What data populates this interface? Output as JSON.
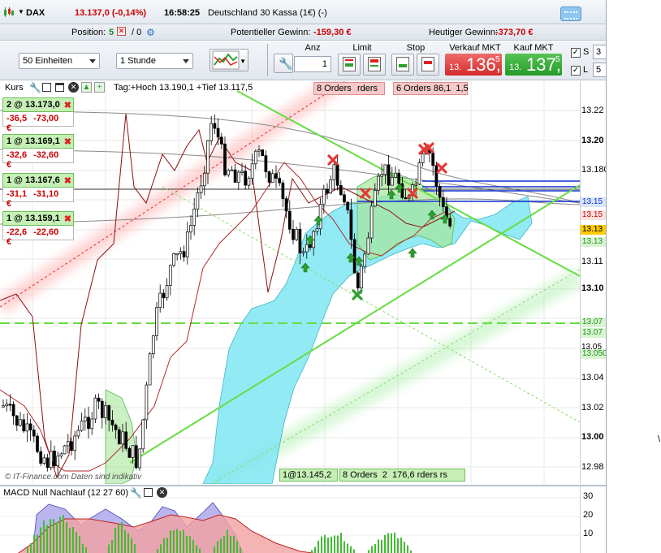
{
  "title_bar": {
    "symbol": "DAX",
    "price": "13.137,0 (-0,14%)",
    "time": "16:58:25",
    "instrument": "Deutschland 30 Kassa (1€) (-)"
  },
  "info_bar": {
    "position_label": "Position:",
    "position_value": "5",
    "position_extra": "/ 0",
    "potential_label": "Potentieller Gewinn:",
    "potential_value": "-159,30 €",
    "daily_label": "Heutiger Gewinn:",
    "daily_value": "-373,70 €"
  },
  "toolbar": {
    "units_select": "50 Einheiten",
    "interval_select": "1 Stunde",
    "anz_label": "Anz",
    "anz_value": "1",
    "limit_label": "Limit",
    "stop_label": "Stop",
    "sell_label": "Verkauf MKT",
    "sell_small": "13.",
    "sell_big": "136,",
    "sell_sup": "5",
    "buy_label": "Kauf MKT",
    "buy_small": "13.",
    "buy_big": "137,",
    "buy_sup": "5",
    "chk_s_label": "S",
    "chk_l_label": "L",
    "s_value": "3",
    "l_value": "5"
  },
  "chart_header": {
    "kurs_label": "Kurs",
    "range_text": "Tag:+Hoch 13.190,1 +Tief 13.117,5"
  },
  "positions": [
    {
      "label": "2 @ 13.173,0",
      "points": "-36,5",
      "money": "-73,00 €"
    },
    {
      "label": "1 @ 13.169,1",
      "points": "-32,6",
      "money": "-32,60 €"
    },
    {
      "label": "1 @ 13.167,6",
      "points": "-31,1",
      "money": "-31,10 €"
    },
    {
      "label": "1 @ 13.159,1",
      "points": "-22,6",
      "money": "-22,60 €"
    }
  ],
  "order_tags": {
    "top_left": "8 Orders",
    "top_left_b": "rders",
    "top_left_c": "rs",
    "top_right": "6 Orders 86,1",
    "top_right_b": "1,5",
    "bottom_a": "1@13.145,2",
    "bottom_b": "8 Orders",
    "bottom_c": "2",
    "bottom_d": "176,6",
    "bottom_e": "rders",
    "bottom_f": "rs"
  },
  "price_axis": {
    "labels": [
      "13.22",
      "13.20",
      "13.180",
      "13.15",
      "13.15",
      "13.13",
      "13.13",
      "13.11",
      "13.10",
      "13.07",
      "13.07",
      "13.05",
      "13.050",
      "13.04",
      "13.02",
      "13.00",
      "12.98"
    ],
    "bold_labels": [
      "13.20",
      "13.10",
      "13.00"
    ]
  },
  "copyright": "© IT-Finance.com Daten sind indikativ",
  "macd": {
    "title": "MACD Null Nachlauf (12 27 60)",
    "axis": [
      "30",
      "20",
      "10"
    ]
  },
  "stray_text": "\\",
  "colors": {
    "cloud": "#7fe6f2",
    "up_candle": "#ffffff",
    "down_candle": "#000000",
    "sell": "#e53935",
    "buy": "#2e9f2e",
    "trend": "#66dd44",
    "loss": "#cc0000"
  }
}
